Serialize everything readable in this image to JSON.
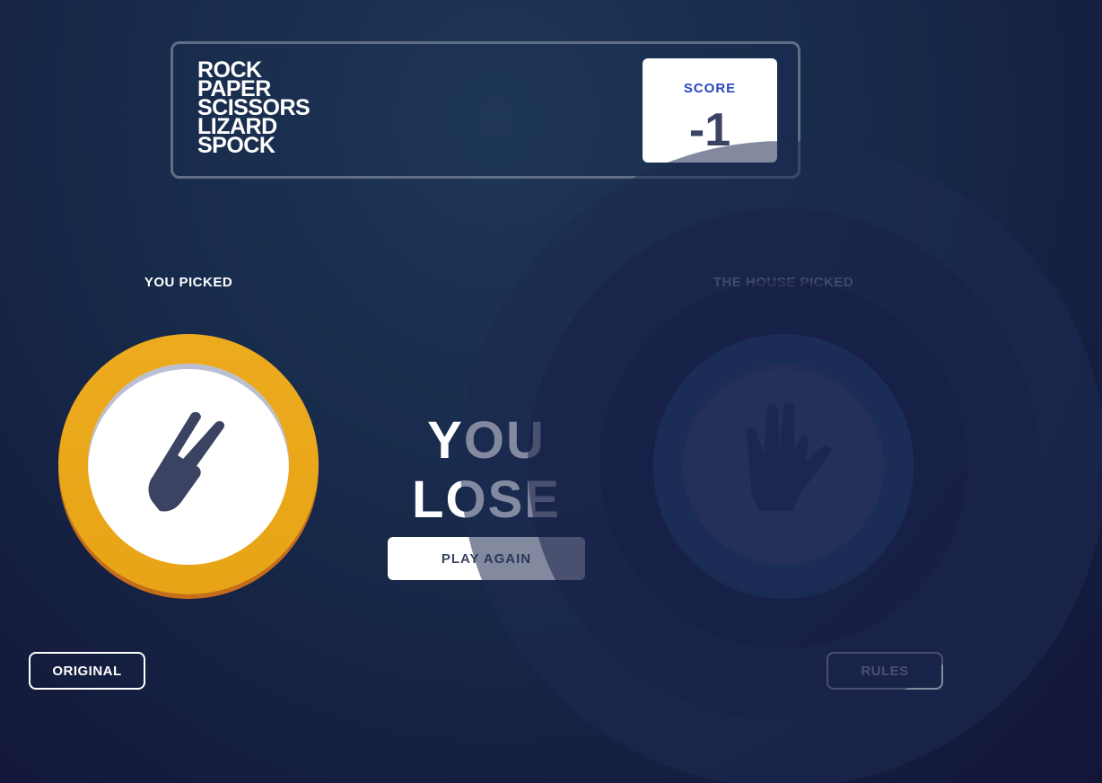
{
  "header": {
    "title_lines": [
      "Rock",
      "Paper",
      "Scissors",
      "Lizard",
      "Spock"
    ],
    "score_label": "Score",
    "score_value": "-1"
  },
  "player": {
    "label": "You picked",
    "choice": "scissors",
    "choice_icon": "scissors-hand-icon",
    "ring_color": "#ecaa1e"
  },
  "house": {
    "label": "The house picked",
    "choice": "spock",
    "choice_icon": "spock-hand-icon",
    "ring_color": "#4fbfdc"
  },
  "result": {
    "text": "You lose",
    "play_again_label": "Play again"
  },
  "buttons": {
    "original_label": "Original",
    "rules_label": "Rules"
  },
  "colors": {
    "background": "#1f3757",
    "score_text": "#2a46c0",
    "dark_text": "#3b4363"
  }
}
